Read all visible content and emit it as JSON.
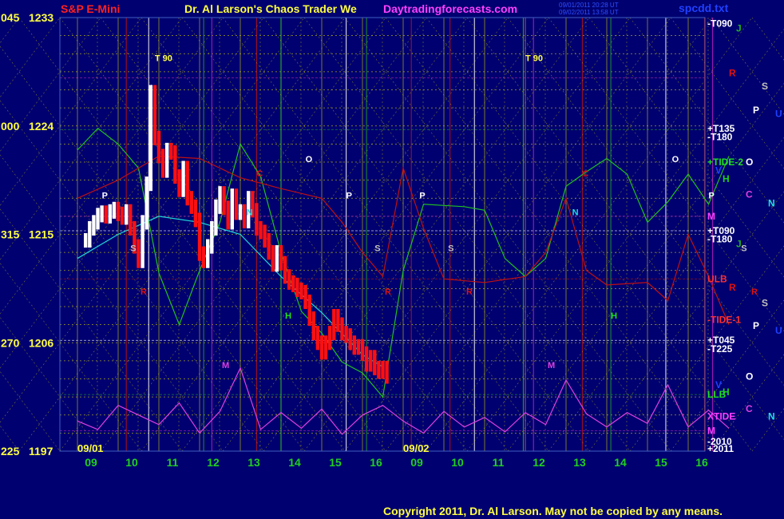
{
  "header": {
    "left_title": "S&P E-Mini",
    "center_title": "Dr. Al Larson's Chaos Trader We",
    "site": "Daytradingforecasts.com",
    "file": "spcdd.txt",
    "stamp1": "09/01/2011 20:28 UT",
    "stamp2": "09/02/2011 13:58 UT"
  },
  "footer": {
    "copyright": "Copyright 2011, Dr. Al Larson. May not be copied by any means."
  },
  "colors": {
    "background": "#000070",
    "grid_yellow": "#d8d800",
    "bar_white": "#ffffff",
    "bar_red": "#ff1010",
    "ma_green": "#20c020",
    "ma_cyan": "#20d8d8",
    "red_line": "#c01010",
    "magenta": "#e040e0"
  },
  "chart_data": {
    "type": "line",
    "title": "S&P E-Mini",
    "ylim": [
      1197,
      1233
    ],
    "y_axis": [
      {
        "deg": "045",
        "price": "1233",
        "value": 1233
      },
      {
        "deg": "000",
        "price": "1224",
        "value": 1224
      },
      {
        "deg": "315",
        "price": "1215",
        "value": 1215
      },
      {
        "deg": "270",
        "price": "1206",
        "value": 1206
      },
      {
        "deg": "225",
        "price": "1197",
        "value": 1197
      }
    ],
    "x_axis": {
      "hour_ticks": [
        "09",
        "10",
        "11",
        "12",
        "13",
        "14",
        "15",
        "16",
        "09",
        "10",
        "11",
        "12",
        "13",
        "14",
        "15",
        "16"
      ],
      "date_labels": [
        "09/01",
        "09/02"
      ]
    },
    "right_labels": [
      {
        "text": "-T090",
        "value": 1232.5,
        "color": "#ffffff"
      },
      {
        "text": "+T135",
        "value": 1223.8,
        "color": "#ffffff"
      },
      {
        "text": "-T180",
        "value": 1223.1,
        "color": "#ffffff"
      },
      {
        "text": "+TIDE-2",
        "value": 1221.0,
        "color": "#20e020"
      },
      {
        "text": "M",
        "value": 1216.5,
        "color": "#ff40ff"
      },
      {
        "text": "+T090",
        "value": 1215.3,
        "color": "#ffffff"
      },
      {
        "text": "-T180",
        "value": 1214.6,
        "color": "#ffffff"
      },
      {
        "text": "ULB",
        "value": 1211.3,
        "color": "#ff3030"
      },
      {
        "text": "-TIDE-1",
        "value": 1207.9,
        "color": "#ff3030"
      },
      {
        "text": "+T045",
        "value": 1206.2,
        "color": "#ffffff"
      },
      {
        "text": "-T225",
        "value": 1205.5,
        "color": "#ffffff"
      },
      {
        "text": "LLB",
        "value": 1201.7,
        "color": "#20e020"
      },
      {
        "text": "XTIDE",
        "value": 1199.9,
        "color": "#ff40ff"
      },
      {
        "text": "M",
        "value": 1198.7,
        "color": "#ff40ff"
      },
      {
        "text": "-2010",
        "value": 1197.8,
        "color": "#ffffff"
      },
      {
        "text": "+2011",
        "value": 1197.2,
        "color": "#ffffff"
      }
    ],
    "planets": [
      {
        "text": "J",
        "value": 1232.1,
        "color": "#20b020"
      },
      {
        "text": "R",
        "value": 1228.4,
        "color": "#e01010"
      },
      {
        "text": "S",
        "value": 1227.3,
        "color": "#c0c0c0"
      },
      {
        "text": "P",
        "value": 1225.3,
        "color": "#ffffff"
      },
      {
        "text": "U",
        "value": 1225.0,
        "color": "#2040ff"
      },
      {
        "text": "O",
        "value": 1221.0,
        "color": "#ffffff"
      },
      {
        "text": "V",
        "value": 1220.3,
        "color": "#2040ff"
      },
      {
        "text": "H",
        "value": 1219.6,
        "color": "#20d020"
      },
      {
        "text": "C",
        "value": 1218.3,
        "color": "#e040e0"
      },
      {
        "text": "N",
        "value": 1217.6,
        "color": "#20e0e0"
      },
      {
        "text": "J",
        "value": 1214.2,
        "color": "#20b020"
      },
      {
        "text": "R",
        "value": 1210.6,
        "color": "#e01010"
      },
      {
        "text": "S",
        "value": 1209.3,
        "color": "#c0c0c0"
      },
      {
        "text": "P",
        "value": 1207.4,
        "color": "#ffffff"
      },
      {
        "text": "U",
        "value": 1207.0,
        "color": "#2040ff"
      },
      {
        "text": "O",
        "value": 1203.2,
        "color": "#ffffff"
      },
      {
        "text": "V",
        "value": 1202.5,
        "color": "#2040ff"
      },
      {
        "text": "H",
        "value": 1201.9,
        "color": "#20d020"
      },
      {
        "text": "C",
        "value": 1200.5,
        "color": "#e040e0"
      },
      {
        "text": "N",
        "value": 1199.9,
        "color": "#20e0e0"
      }
    ],
    "annotations": [
      {
        "text": "T  90",
        "hour": 1.9,
        "value": 1229.4,
        "color": "#ffff40"
      },
      {
        "text": "T  90",
        "hour": 11.0,
        "value": 1229.4,
        "color": "#ffff40"
      },
      {
        "text": "O",
        "hour": 5.6,
        "value": 1221.0,
        "color": "#ffffff"
      },
      {
        "text": "O",
        "hour": 14.6,
        "value": 1221.0,
        "color": "#ffffff"
      },
      {
        "text": "P",
        "hour": 0.6,
        "value": 1218.0,
        "color": "#ffffff"
      },
      {
        "text": "P",
        "hour": 6.6,
        "value": 1218.0,
        "color": "#ffffff"
      },
      {
        "text": "P",
        "hour": 8.4,
        "value": 1218.0,
        "color": "#ffffff"
      },
      {
        "text": "P",
        "hour": 15.5,
        "value": 1218.0,
        "color": "#ffffff"
      },
      {
        "text": "C",
        "hour": 4.4,
        "value": 1219.8,
        "color": "#e01010"
      },
      {
        "text": "C",
        "hour": 12.4,
        "value": 1219.8,
        "color": "#e01010"
      },
      {
        "text": "N",
        "hour": 4.15,
        "value": 1216.6,
        "color": "#20e0e0"
      },
      {
        "text": "N",
        "hour": 12.15,
        "value": 1216.6,
        "color": "#20e0e0"
      },
      {
        "text": "S",
        "hour": 1.3,
        "value": 1213.6,
        "color": "#c0c0c0"
      },
      {
        "text": "S",
        "hour": 7.3,
        "value": 1213.6,
        "color": "#c0c0c0"
      },
      {
        "text": "S",
        "hour": 9.1,
        "value": 1213.6,
        "color": "#c0c0c0"
      },
      {
        "text": "S",
        "hour": 16.3,
        "value": 1213.6,
        "color": "#c0c0c0"
      },
      {
        "text": "R",
        "hour": 1.55,
        "value": 1210.0,
        "color": "#e01010"
      },
      {
        "text": "R",
        "hour": 7.55,
        "value": 1210.0,
        "color": "#e01010"
      },
      {
        "text": "R",
        "hour": 9.55,
        "value": 1210.0,
        "color": "#e01010"
      },
      {
        "text": "R",
        "hour": 16.55,
        "value": 1210.0,
        "color": "#e01010"
      },
      {
        "text": "H",
        "hour": 5.1,
        "value": 1208.0,
        "color": "#20e020"
      },
      {
        "text": "H",
        "hour": 13.1,
        "value": 1208.0,
        "color": "#20e020"
      },
      {
        "text": "M",
        "hour": 3.55,
        "value": 1203.9,
        "color": "#e040e0"
      },
      {
        "text": "M",
        "hour": 11.55,
        "value": 1203.9,
        "color": "#e040e0"
      }
    ],
    "series": [
      {
        "kind": "bars",
        "x": [
          0.2,
          0.3,
          0.4,
          0.5,
          0.6,
          0.7,
          0.8,
          0.9,
          1.0,
          1.1,
          1.2,
          1.3,
          1.4,
          1.5,
          1.6,
          1.7,
          1.8,
          1.9,
          2.0,
          2.1,
          2.2,
          2.3,
          2.4,
          2.5,
          2.6,
          2.7,
          2.8,
          2.9,
          3.0,
          3.1,
          3.2,
          3.3,
          3.4,
          3.5,
          3.6,
          3.7,
          3.8,
          3.9,
          4.0,
          4.1,
          4.2,
          4.3,
          4.4,
          4.5,
          4.6,
          4.7,
          4.8,
          4.9,
          5.0,
          5.1,
          5.2,
          5.3,
          5.4,
          5.5,
          5.6,
          5.7,
          5.8,
          5.9,
          6.0,
          6.1,
          6.2,
          6.3,
          6.4,
          6.5,
          6.6,
          6.7,
          6.8,
          6.9,
          7.0,
          7.1,
          7.2,
          7.3,
          7.4,
          7.5,
          7.6
        ],
        "values": [
          1214.5,
          1215.5,
          1216.0,
          1216.6,
          1216.8,
          1216.5,
          1216.9,
          1217.1,
          1216.7,
          1216.4,
          1216.9,
          1215.5,
          1214.0,
          1212.8,
          1216.0,
          1219.2,
          1226.8,
          1223.0,
          1221.5,
          1220.3,
          1222.0,
          1221.8,
          1219.8,
          1218.7,
          1220.5,
          1218.0,
          1217.3,
          1216.2,
          1213.4,
          1212.8,
          1214.0,
          1215.5,
          1217.3,
          1218.4,
          1217.2,
          1216.0,
          1218.2,
          1216.8,
          1216.9,
          1216.1,
          1218.0,
          1217.0,
          1215.5,
          1215.2,
          1214.5,
          1213.5,
          1212.5,
          1213.5,
          1212.6,
          1211.5,
          1211.0,
          1210.8,
          1210.4,
          1210.2,
          1209.4,
          1208.0,
          1206.8,
          1206.0,
          1205.2,
          1206.0,
          1206.8,
          1208.2,
          1207.5,
          1206.8,
          1206.6,
          1206.0,
          1205.6,
          1205.7,
          1205.1,
          1204.2,
          1204.8,
          1203.9,
          1203.6,
          1203.9,
          1203.2
        ]
      },
      {
        "kind": "line",
        "color": "#20c020",
        "x": [
          0.0,
          0.5,
          1.0,
          1.5,
          2.0,
          2.5,
          3.0,
          3.5,
          4.0,
          4.5,
          5.0,
          5.5,
          6.0,
          6.5,
          7.0,
          7.5,
          8.0,
          8.5,
          9.0,
          9.5,
          10.0,
          10.5,
          11.0,
          11.5,
          12.0,
          12.5,
          13.0,
          13.5,
          14.0,
          14.5,
          15.0,
          15.5,
          16.0
        ],
        "values": [
          1222.0,
          1223.8,
          1222.5,
          1220.5,
          1211.8,
          1207.5,
          1212.0,
          1216.0,
          1222.5,
          1219.8,
          1213.5,
          1208.6,
          1206.8,
          1204.4,
          1203.5,
          1201.5,
          1212.0,
          1217.5,
          1217.4,
          1217.3,
          1217.0,
          1213.0,
          1211.5,
          1213.0,
          1219.0,
          1220.2,
          1221.3,
          1220.0,
          1216.0,
          1217.7,
          1220.0,
          1217.5,
          1221.5
        ]
      },
      {
        "kind": "line",
        "color": "#20d8d8",
        "x": [
          0.0,
          1.0,
          2.0,
          3.0,
          4.0,
          5.0,
          6.0,
          7.0,
          7.5
        ],
        "values": [
          1213.0,
          1215.0,
          1216.5,
          1216.0,
          1215.0,
          1211.5,
          1208.5,
          1205.0,
          1204.0
        ]
      },
      {
        "kind": "line",
        "color": "#c01010",
        "x": [
          0.0,
          1.0,
          2.0,
          3.0,
          4.0,
          5.0,
          6.0,
          6.5,
          7.0,
          7.5,
          8.0,
          8.5,
          9.0,
          10.0,
          11.0,
          11.5,
          12.0,
          12.5,
          13.0,
          14.0,
          14.5,
          15.0,
          15.5,
          16.0
        ],
        "values": [
          1218.0,
          1219.5,
          1221.5,
          1221.3,
          1219.7,
          1218.8,
          1218.0,
          1216.0,
          1213.5,
          1211.5,
          1220.5,
          1215.5,
          1211.3,
          1211.0,
          1211.5,
          1213.5,
          1218.0,
          1212.0,
          1210.8,
          1211.0,
          1209.5,
          1215.0,
          1211.5,
          1207.5
        ]
      },
      {
        "kind": "line",
        "color": "#e040e0",
        "x": [
          0.0,
          0.5,
          1.0,
          1.5,
          2.0,
          2.5,
          3.0,
          3.5,
          4.0,
          4.5,
          5.0,
          5.5,
          6.0,
          6.5,
          7.0,
          7.5,
          8.0,
          8.5,
          9.0,
          9.5,
          10.0,
          10.5,
          11.0,
          11.5,
          12.0,
          12.5,
          13.0,
          13.5,
          14.0,
          14.5,
          15.0,
          15.5,
          16.0
        ],
        "values": [
          1199.5,
          1198.8,
          1200.8,
          1200.0,
          1199.2,
          1201.0,
          1198.5,
          1200.3,
          1203.9,
          1198.8,
          1200.2,
          1198.9,
          1200.5,
          1198.4,
          1200.0,
          1200.8,
          1199.5,
          1198.5,
          1200.3,
          1199.0,
          1199.8,
          1198.6,
          1200.2,
          1199.2,
          1202.9,
          1200.1,
          1199.0,
          1200.2,
          1199.3,
          1202.5,
          1199.0,
          1200.4,
          1198.9
        ]
      }
    ]
  }
}
